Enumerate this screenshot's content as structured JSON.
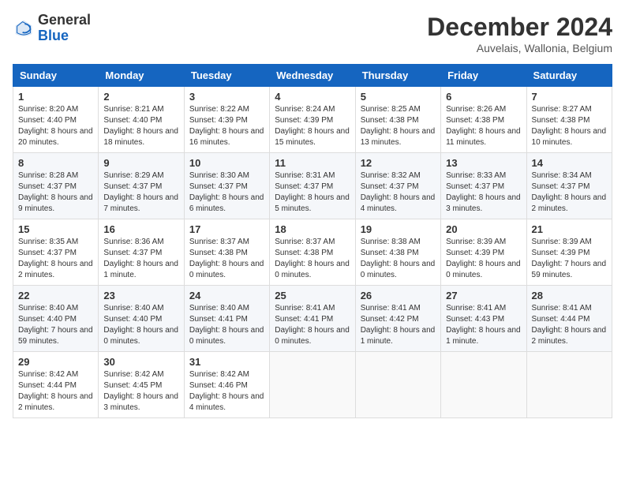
{
  "header": {
    "logo_general": "General",
    "logo_blue": "Blue",
    "month_title": "December 2024",
    "subtitle": "Auvelais, Wallonia, Belgium"
  },
  "calendar": {
    "days_of_week": [
      "Sunday",
      "Monday",
      "Tuesday",
      "Wednesday",
      "Thursday",
      "Friday",
      "Saturday"
    ],
    "weeks": [
      [
        {
          "day": "1",
          "sunrise": "Sunrise: 8:20 AM",
          "sunset": "Sunset: 4:40 PM",
          "daylight": "Daylight: 8 hours and 20 minutes."
        },
        {
          "day": "2",
          "sunrise": "Sunrise: 8:21 AM",
          "sunset": "Sunset: 4:40 PM",
          "daylight": "Daylight: 8 hours and 18 minutes."
        },
        {
          "day": "3",
          "sunrise": "Sunrise: 8:22 AM",
          "sunset": "Sunset: 4:39 PM",
          "daylight": "Daylight: 8 hours and 16 minutes."
        },
        {
          "day": "4",
          "sunrise": "Sunrise: 8:24 AM",
          "sunset": "Sunset: 4:39 PM",
          "daylight": "Daylight: 8 hours and 15 minutes."
        },
        {
          "day": "5",
          "sunrise": "Sunrise: 8:25 AM",
          "sunset": "Sunset: 4:38 PM",
          "daylight": "Daylight: 8 hours and 13 minutes."
        },
        {
          "day": "6",
          "sunrise": "Sunrise: 8:26 AM",
          "sunset": "Sunset: 4:38 PM",
          "daylight": "Daylight: 8 hours and 11 minutes."
        },
        {
          "day": "7",
          "sunrise": "Sunrise: 8:27 AM",
          "sunset": "Sunset: 4:38 PM",
          "daylight": "Daylight: 8 hours and 10 minutes."
        }
      ],
      [
        {
          "day": "8",
          "sunrise": "Sunrise: 8:28 AM",
          "sunset": "Sunset: 4:37 PM",
          "daylight": "Daylight: 8 hours and 9 minutes."
        },
        {
          "day": "9",
          "sunrise": "Sunrise: 8:29 AM",
          "sunset": "Sunset: 4:37 PM",
          "daylight": "Daylight: 8 hours and 7 minutes."
        },
        {
          "day": "10",
          "sunrise": "Sunrise: 8:30 AM",
          "sunset": "Sunset: 4:37 PM",
          "daylight": "Daylight: 8 hours and 6 minutes."
        },
        {
          "day": "11",
          "sunrise": "Sunrise: 8:31 AM",
          "sunset": "Sunset: 4:37 PM",
          "daylight": "Daylight: 8 hours and 5 minutes."
        },
        {
          "day": "12",
          "sunrise": "Sunrise: 8:32 AM",
          "sunset": "Sunset: 4:37 PM",
          "daylight": "Daylight: 8 hours and 4 minutes."
        },
        {
          "day": "13",
          "sunrise": "Sunrise: 8:33 AM",
          "sunset": "Sunset: 4:37 PM",
          "daylight": "Daylight: 8 hours and 3 minutes."
        },
        {
          "day": "14",
          "sunrise": "Sunrise: 8:34 AM",
          "sunset": "Sunset: 4:37 PM",
          "daylight": "Daylight: 8 hours and 2 minutes."
        }
      ],
      [
        {
          "day": "15",
          "sunrise": "Sunrise: 8:35 AM",
          "sunset": "Sunset: 4:37 PM",
          "daylight": "Daylight: 8 hours and 2 minutes."
        },
        {
          "day": "16",
          "sunrise": "Sunrise: 8:36 AM",
          "sunset": "Sunset: 4:37 PM",
          "daylight": "Daylight: 8 hours and 1 minute."
        },
        {
          "day": "17",
          "sunrise": "Sunrise: 8:37 AM",
          "sunset": "Sunset: 4:38 PM",
          "daylight": "Daylight: 8 hours and 0 minutes."
        },
        {
          "day": "18",
          "sunrise": "Sunrise: 8:37 AM",
          "sunset": "Sunset: 4:38 PM",
          "daylight": "Daylight: 8 hours and 0 minutes."
        },
        {
          "day": "19",
          "sunrise": "Sunrise: 8:38 AM",
          "sunset": "Sunset: 4:38 PM",
          "daylight": "Daylight: 8 hours and 0 minutes."
        },
        {
          "day": "20",
          "sunrise": "Sunrise: 8:39 AM",
          "sunset": "Sunset: 4:39 PM",
          "daylight": "Daylight: 8 hours and 0 minutes."
        },
        {
          "day": "21",
          "sunrise": "Sunrise: 8:39 AM",
          "sunset": "Sunset: 4:39 PM",
          "daylight": "Daylight: 7 hours and 59 minutes."
        }
      ],
      [
        {
          "day": "22",
          "sunrise": "Sunrise: 8:40 AM",
          "sunset": "Sunset: 4:40 PM",
          "daylight": "Daylight: 7 hours and 59 minutes."
        },
        {
          "day": "23",
          "sunrise": "Sunrise: 8:40 AM",
          "sunset": "Sunset: 4:40 PM",
          "daylight": "Daylight: 8 hours and 0 minutes."
        },
        {
          "day": "24",
          "sunrise": "Sunrise: 8:40 AM",
          "sunset": "Sunset: 4:41 PM",
          "daylight": "Daylight: 8 hours and 0 minutes."
        },
        {
          "day": "25",
          "sunrise": "Sunrise: 8:41 AM",
          "sunset": "Sunset: 4:41 PM",
          "daylight": "Daylight: 8 hours and 0 minutes."
        },
        {
          "day": "26",
          "sunrise": "Sunrise: 8:41 AM",
          "sunset": "Sunset: 4:42 PM",
          "daylight": "Daylight: 8 hours and 1 minute."
        },
        {
          "day": "27",
          "sunrise": "Sunrise: 8:41 AM",
          "sunset": "Sunset: 4:43 PM",
          "daylight": "Daylight: 8 hours and 1 minute."
        },
        {
          "day": "28",
          "sunrise": "Sunrise: 8:41 AM",
          "sunset": "Sunset: 4:44 PM",
          "daylight": "Daylight: 8 hours and 2 minutes."
        }
      ],
      [
        {
          "day": "29",
          "sunrise": "Sunrise: 8:42 AM",
          "sunset": "Sunset: 4:44 PM",
          "daylight": "Daylight: 8 hours and 2 minutes."
        },
        {
          "day": "30",
          "sunrise": "Sunrise: 8:42 AM",
          "sunset": "Sunset: 4:45 PM",
          "daylight": "Daylight: 8 hours and 3 minutes."
        },
        {
          "day": "31",
          "sunrise": "Sunrise: 8:42 AM",
          "sunset": "Sunset: 4:46 PM",
          "daylight": "Daylight: 8 hours and 4 minutes."
        },
        null,
        null,
        null,
        null
      ]
    ]
  }
}
